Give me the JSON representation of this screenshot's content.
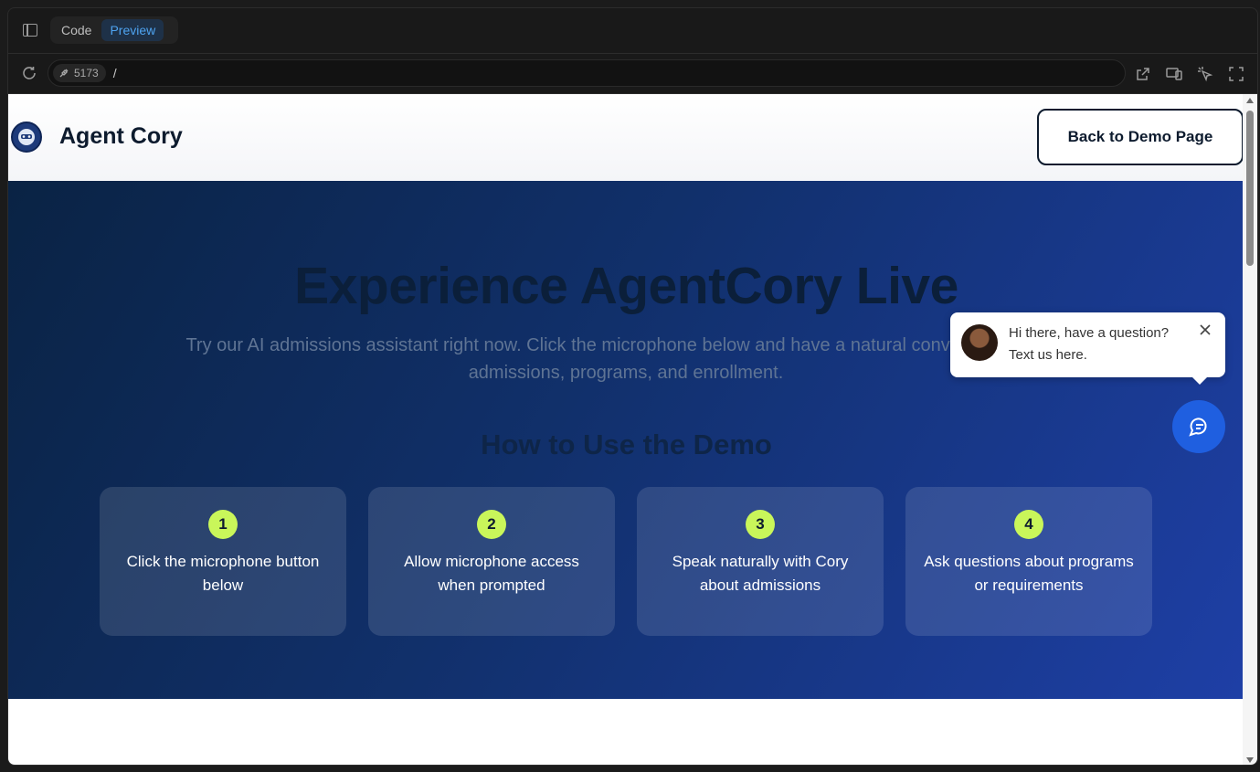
{
  "ide": {
    "tabs": [
      {
        "label": "Code"
      },
      {
        "label": "Preview"
      }
    ],
    "port": "5173",
    "path": "/"
  },
  "site": {
    "brand": "Agent Cory",
    "back_button": "Back to Demo Page"
  },
  "hero": {
    "title": "Experience AgentCory Live",
    "subtitle": "Try our AI admissions assistant right now. Click the microphone below and have a natural conversation about admissions, programs, and enrollment.",
    "howto_title": "How to Use the Demo",
    "steps": [
      {
        "num": "1",
        "text": "Click the microphone button below"
      },
      {
        "num": "2",
        "text": "Allow microphone access when prompted"
      },
      {
        "num": "3",
        "text": "Speak naturally with Cory about admissions"
      },
      {
        "num": "4",
        "text": "Ask questions about programs or requirements"
      }
    ]
  },
  "chat": {
    "message": "Hi there, have a question? Text us here."
  },
  "colors": {
    "accent": "#c9f65a",
    "chat_fab": "#1f5fe0",
    "hero_start": "#0a2344",
    "hero_end": "#1e3fa6"
  }
}
